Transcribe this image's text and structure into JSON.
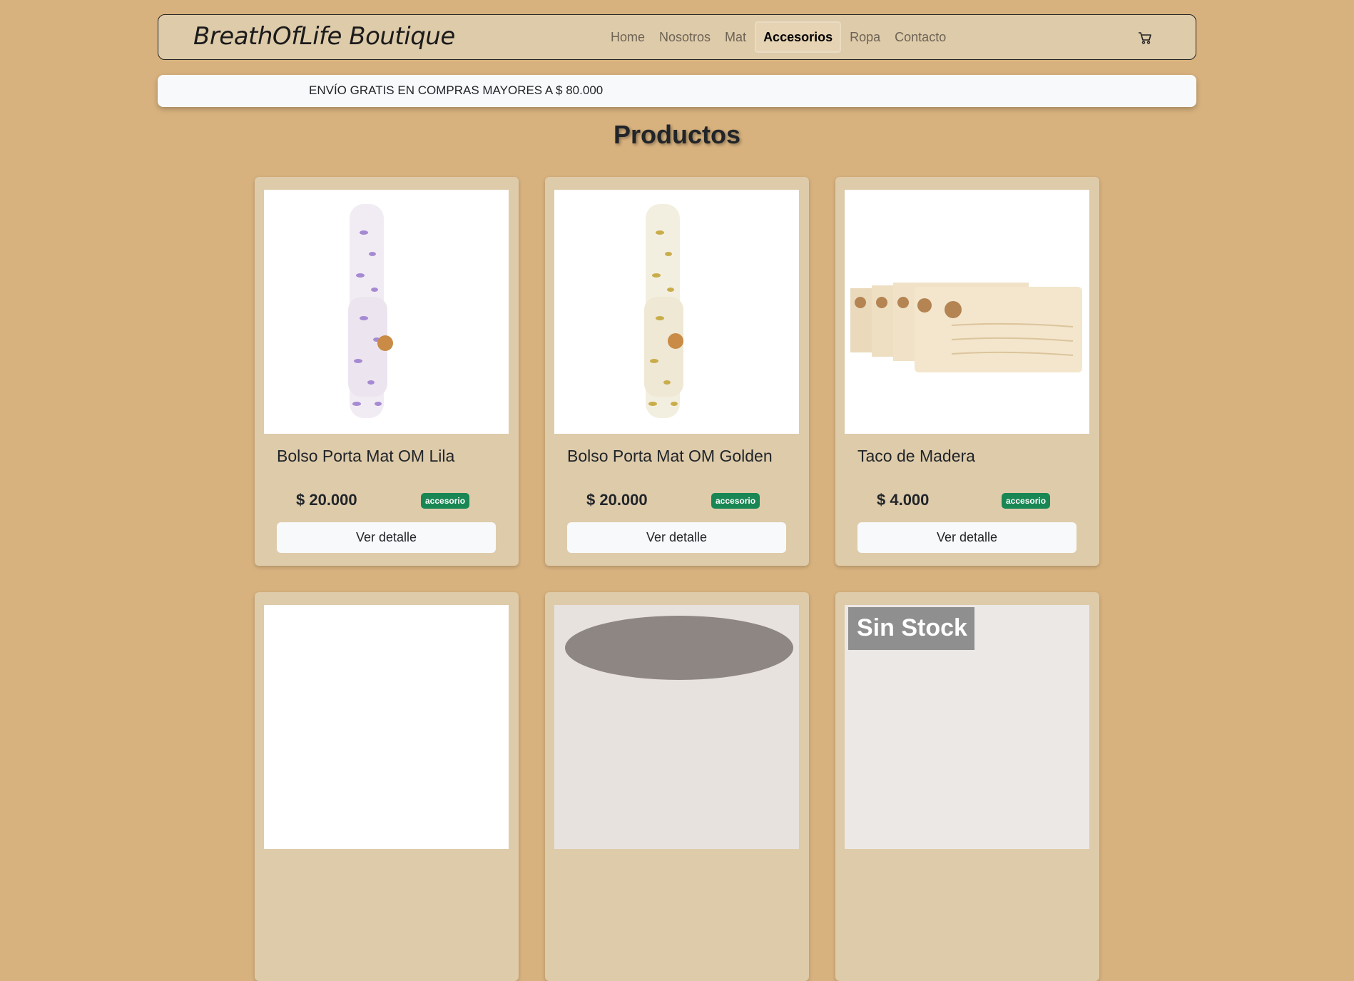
{
  "brand": "BreathOfLife Boutique",
  "nav": [
    "Home",
    "Nosotros",
    "Mat",
    "Accesorios",
    "Ropa",
    "Contacto"
  ],
  "banner": "ENVÍO GRATIS EN COMPRAS MAYORES A $ 80.000",
  "page_title": "Productos",
  "products": [
    {
      "name": "Bolso Porta Mat OM Lila",
      "price": "$ 20.000",
      "badge": "accesorio",
      "button": "Ver detalle"
    },
    {
      "name": "Bolso Porta Mat OM Golden",
      "price": "$ 20.000",
      "badge": "accesorio",
      "button": "Ver detalle"
    },
    {
      "name": "Taco de Madera",
      "price": "$ 4.000",
      "badge": "accesorio",
      "button": "Ver detalle"
    }
  ],
  "row2_partial_text": "Sin Stock",
  "colors": {
    "background": "#d8b27e",
    "card": "#decbaa",
    "badge": "#198754"
  },
  "icons": [
    "cart-icon"
  ]
}
